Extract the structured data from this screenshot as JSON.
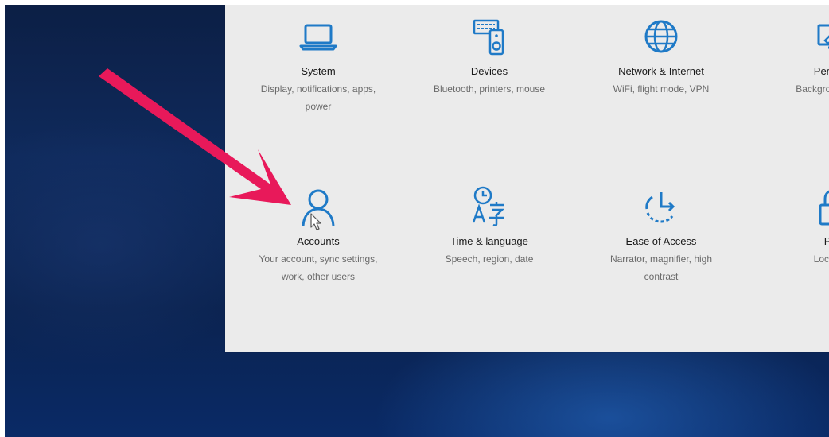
{
  "settings": {
    "row1": [
      {
        "id": "system",
        "name": "System",
        "desc": "Display, notifications, apps, power",
        "icon": "laptop-icon"
      },
      {
        "id": "devices",
        "name": "Devices",
        "desc": "Bluetooth, printers, mouse",
        "icon": "keyboard-speaker-icon"
      },
      {
        "id": "network",
        "name": "Network & Internet",
        "desc": "WiFi, flight mode, VPN",
        "icon": "globe-icon"
      },
      {
        "id": "personalisation",
        "name": "Persona",
        "desc": "Backgrou screen,",
        "icon": "pen-display-icon"
      }
    ],
    "row2": [
      {
        "id": "accounts",
        "name": "Accounts",
        "desc": "Your account, sync settings, work, other users",
        "icon": "person-icon"
      },
      {
        "id": "time-language",
        "name": "Time & language",
        "desc": "Speech, region, date",
        "icon": "clock-language-icon"
      },
      {
        "id": "ease-of-access",
        "name": "Ease of Access",
        "desc": "Narrator, magnifier, high contrast",
        "icon": "ease-of-access-icon"
      },
      {
        "id": "privacy",
        "name": "Priv",
        "desc": "Location,",
        "icon": "lock-icon"
      }
    ]
  },
  "colors": {
    "accent": "#1f7ac7",
    "arrow": "#e8195a",
    "panel": "#ebebeb"
  }
}
